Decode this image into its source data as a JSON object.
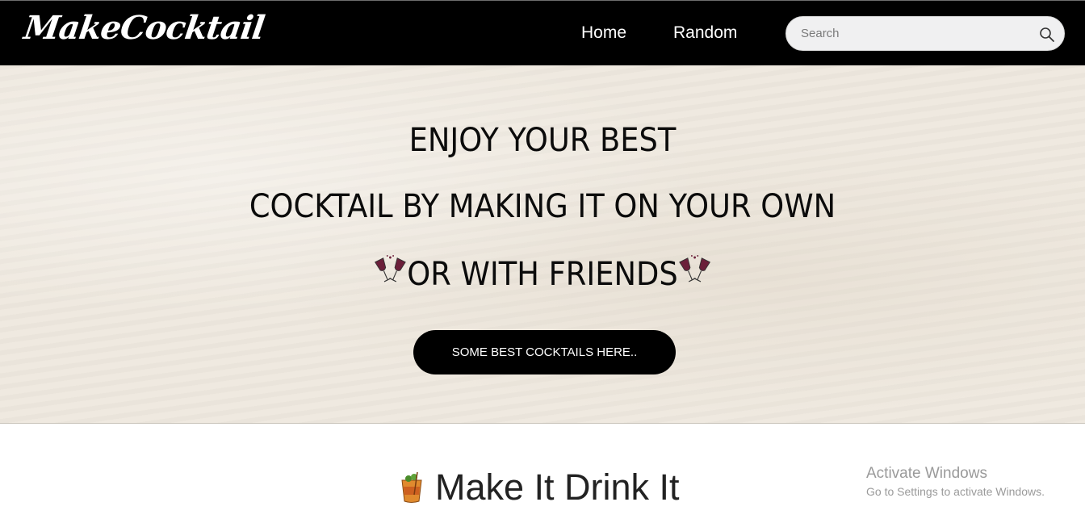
{
  "navbar": {
    "brand": "MakeCocktail",
    "links": [
      "Home",
      "Random"
    ],
    "search_placeholder": "Search"
  },
  "hero": {
    "line1": "ENJOY YOUR BEST",
    "line2": "COCKTAIL BY MAKING IT ON YOUR OWN",
    "line3": "OR WITH FRIENDS",
    "button_label": "SOME BEST COCKTAILS HERE.."
  },
  "section": {
    "title": "Make It Drink It"
  },
  "watermark": {
    "title": "Activate Windows",
    "subtitle": "Go to Settings to activate Windows."
  },
  "icons": [
    "search-icon",
    "wine-glasses-icon",
    "cocktail-icon"
  ],
  "colors": {
    "navbar": "#000000",
    "hero_bg": "#efe9df",
    "button": "#000000",
    "wine": "#6b1f3a"
  }
}
